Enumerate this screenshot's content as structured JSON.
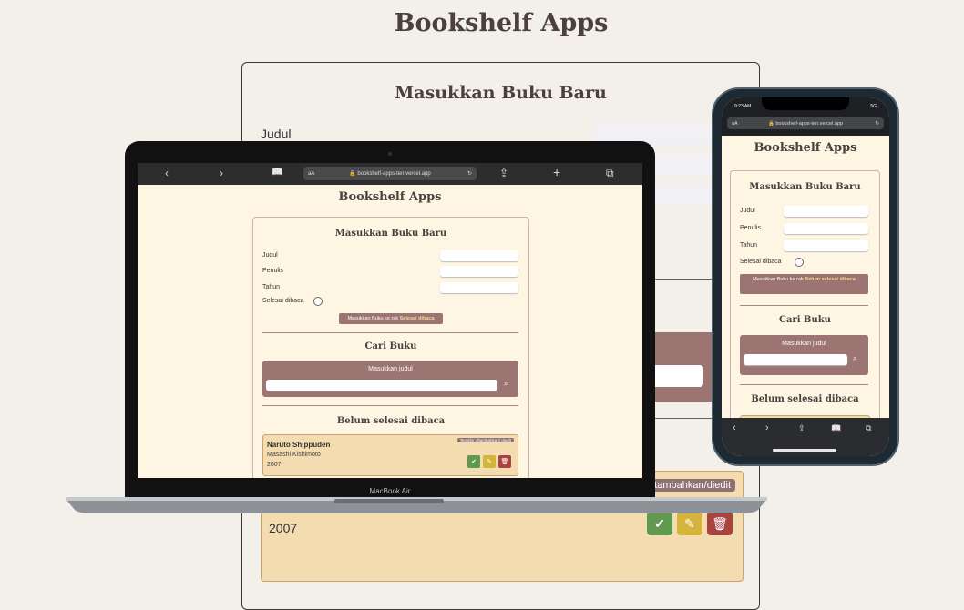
{
  "app_title": "Bookshelf Apps",
  "form": {
    "title": "Masukkan Buku Baru",
    "title_label": "Judul",
    "author_label": "Penulis",
    "year_label": "Tahun",
    "complete_label": "Selesai dibaca",
    "submit_prefix": "Masukkan Buku ke rak",
    "submit_shelf": "Selesai dibaca",
    "submit_shelf_phone": "Belum selesai dibaca"
  },
  "search": {
    "title": "Cari Buku",
    "label": "Masukkan judul"
  },
  "shelf_incomplete": {
    "title": "Belum selesai dibaca"
  },
  "book": {
    "title": "Naruto Shippuden",
    "author": "Masashi Kishimoto",
    "year": "2007",
    "badge": "Terakhir ditambahkan/ diedit",
    "badge_bg": "ditambahkan/diedit"
  },
  "browser": {
    "aa": "aA",
    "url": "bookshelf-apps-ten.vercel.app"
  },
  "laptop": {
    "label": "MacBook Air"
  },
  "phone": {
    "time": "9:23 AM",
    "signal": "5G"
  },
  "icons": [
    "back-icon",
    "forward-icon",
    "book-icon",
    "lock-icon",
    "reload-icon",
    "share-icon",
    "plus-icon",
    "tabs-icon",
    "search-icon",
    "check-icon",
    "pencil-icon",
    "trash-icon",
    "checkbox-icon"
  ],
  "colors": {
    "bg": "#f3efe9",
    "cream": "#fff5e3",
    "mauve": "#9c7472",
    "green": "#5f9a4e",
    "yellow": "#d4b43a",
    "red": "#a8433f",
    "book": "#f3ddb0"
  }
}
